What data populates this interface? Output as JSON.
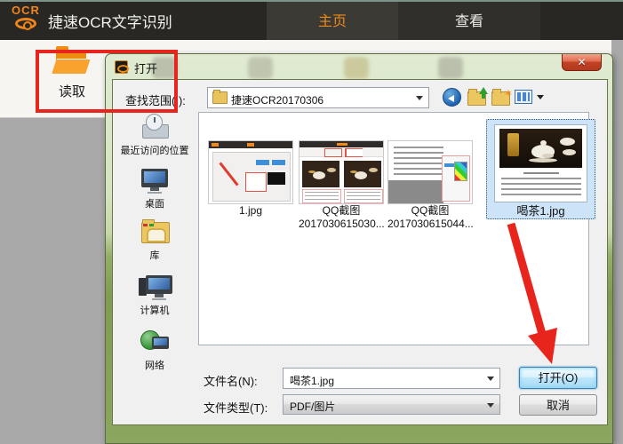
{
  "app": {
    "logo_text": "OCR",
    "title": "捷速OCR文字识别",
    "tabs": [
      {
        "label": "主页",
        "active": true
      },
      {
        "label": "查看",
        "active": false
      }
    ],
    "ribbon": {
      "read_label": "读取"
    }
  },
  "dialog": {
    "title": "打开",
    "close_glyph": "✕",
    "lookin_label": "查找范围(I):",
    "lookin_value": "捷速OCR20170306",
    "nav": {
      "back": "back-button",
      "up": "up-one-level-button",
      "new_folder": "new-folder-button",
      "views": "views-menu-button"
    },
    "places": [
      {
        "label": "最近访问的位置",
        "icon": "recent-places-icon"
      },
      {
        "label": "桌面",
        "icon": "desktop-icon"
      },
      {
        "label": "库",
        "icon": "libraries-icon"
      },
      {
        "label": "计算机",
        "icon": "computer-icon"
      },
      {
        "label": "网络",
        "icon": "network-icon"
      }
    ],
    "files": [
      {
        "line1": "1.jpg",
        "selected": false
      },
      {
        "line1": "QQ截图",
        "line2": "2017030615030...",
        "selected": false
      },
      {
        "line1": "QQ截图",
        "line2": "2017030615044...",
        "selected": false
      },
      {
        "line1": "喝茶1.jpg",
        "selected": true
      }
    ],
    "filename_label": "文件名(N):",
    "filename_value": "喝茶1.jpg",
    "filetype_label": "文件类型(T):",
    "filetype_value": "PDF/图片",
    "open_button": "打开(O)",
    "cancel_button": "取消"
  },
  "colors": {
    "accent_orange": "#f08919",
    "annotation_red": "#e8251d",
    "selection_blue": "#cde3f7",
    "dialog_glass_green": "#809c53",
    "titlebar_dark": "#282724"
  }
}
